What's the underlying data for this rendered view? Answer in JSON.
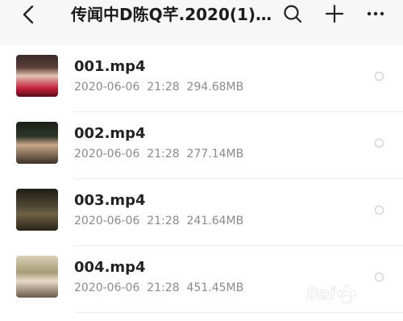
{
  "header": {
    "title": "传闻中D陈Q芊.2020(1)...",
    "back_icon": "chevron-left-icon",
    "search_icon": "search-icon",
    "add_icon": "plus-icon",
    "more_icon": "more-horizontal-icon"
  },
  "files": [
    {
      "name": "001.mp4",
      "date": "2020-06-06",
      "time": "21:28",
      "size": "294.68MB"
    },
    {
      "name": "002.mp4",
      "date": "2020-06-06",
      "time": "21:28",
      "size": "277.14MB"
    },
    {
      "name": "003.mp4",
      "date": "2020-06-06",
      "time": "21:28",
      "size": "241.64MB"
    },
    {
      "name": "004.mp4",
      "date": "2020-06-06",
      "time": "21:28",
      "size": "451.45MB"
    }
  ],
  "colors": {
    "header_bg": "#f7f7f7",
    "title": "#1c1c1c",
    "meta": "#8a8a8a",
    "radio_border": "#c9c9c9"
  }
}
